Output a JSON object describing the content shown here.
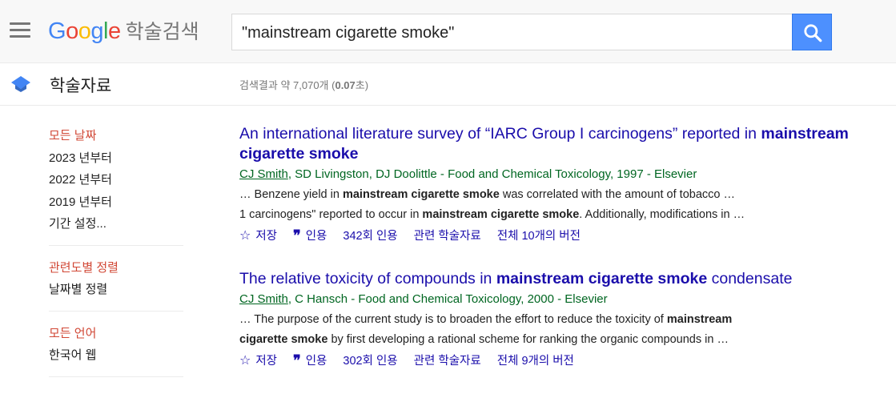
{
  "header": {
    "logo_text": "Google",
    "logo_suffix": "학술검색",
    "search_query": "\"mainstream cigarette smoke\""
  },
  "subheader": {
    "section_title": "학술자료",
    "stats_prefix": "검색결과 약 7,070개 (",
    "stats_time": "0.07",
    "stats_suffix": "초)"
  },
  "sidebar": {
    "date_filters": [
      "모든 날짜",
      "2023 년부터",
      "2022 년부터",
      "2019 년부터",
      "기간 설정..."
    ],
    "sort_options": [
      "관련도별 정렬",
      "날짜별 정렬"
    ],
    "language_options": [
      "모든 언어",
      "한국어 웹"
    ]
  },
  "results": [
    {
      "title_pre": "An international literature survey of “IARC Group I carcinogens” reported in ",
      "title_bold": "mainstream cigarette smoke",
      "title_post": "",
      "first_author": "CJ Smith",
      "meta_rest": ", SD Livingston, DJ Doolittle - Food and Chemical Toxicology, 1997 - Elsevier",
      "s1_pre": "… Benzene yield in ",
      "s1_bold": "mainstream cigarette smoke",
      "s1_post": " was correlated with the amount of tobacco …",
      "s2_pre": "1 carcinogens\" reported to occur in ",
      "s2_bold": "mainstream cigarette smoke",
      "s2_post": ". Additionally, modifications in …",
      "save_label": "저장",
      "cite_label": "인용",
      "cited_by": "342회 인용",
      "related": "관련 학술자료",
      "versions": "전체 10개의 버전"
    },
    {
      "title_pre": "The relative toxicity of compounds in ",
      "title_bold": "mainstream cigarette smoke",
      "title_post": " condensate",
      "first_author": "CJ Smith",
      "meta_rest": ", C Hansch - Food and Chemical Toxicology, 2000 - Elsevier",
      "s1_pre": "… The purpose of the current study is to broaden the effort to reduce the toxicity of ",
      "s1_bold": "mainstream",
      "s1_post": "",
      "s2_pre": "",
      "s2_bold": "cigarette smoke",
      "s2_post": " by first developing a rational scheme for ranking the organic compounds in …",
      "save_label": "저장",
      "cite_label": "인용",
      "cited_by": "302회 인용",
      "related": "관련 학술자료",
      "versions": "전체 9개의 버전"
    }
  ],
  "icons": {
    "menu": "hamburger-menu-icon",
    "search": "search-icon",
    "scholar": "scholar-cap-icon",
    "save": "star-icon",
    "cite": "quote-icon"
  },
  "colors": {
    "link": "#1a0dab",
    "meta_green": "#006621",
    "active_filter": "#d14836",
    "search_button": "#4d90fe"
  }
}
